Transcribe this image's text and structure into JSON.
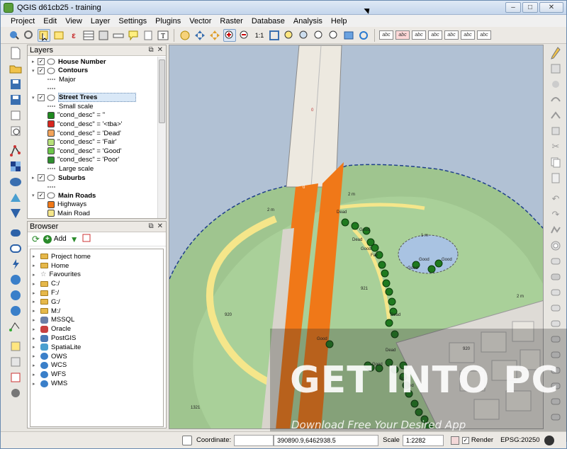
{
  "window": {
    "title": "QGIS d61cb25 - training"
  },
  "menubar": [
    "Project",
    "Edit",
    "View",
    "Layer",
    "Settings",
    "Plugins",
    "Vector",
    "Raster",
    "Database",
    "Analysis",
    "Help"
  ],
  "layers_panel": {
    "title": "Layers",
    "items": [
      {
        "label": "House Number",
        "bold": true,
        "checked": true,
        "expand": "+"
      },
      {
        "label": "Contours",
        "bold": true,
        "checked": true,
        "expand": "-"
      },
      {
        "label": "Major",
        "bold": false
      },
      {
        "label": "",
        "bold": false
      },
      {
        "label": "Street Trees",
        "bold": true,
        "checked": true,
        "expand": "-",
        "selected": true
      },
      {
        "label": "Small scale",
        "bold": false
      },
      {
        "label": "\"cond_desc\" = ''",
        "bold": false,
        "color": "#1f8a1f"
      },
      {
        "label": "\"cond_desc\" = '<tba>'",
        "bold": false,
        "color": "#d8271f"
      },
      {
        "label": "\"cond_desc\" = 'Dead'",
        "bold": false,
        "color": "#f2a35a"
      },
      {
        "label": "\"cond_desc\" = 'Fair'",
        "bold": false,
        "color": "#b7e07a"
      },
      {
        "label": "\"cond_desc\" = 'Good'",
        "bold": false,
        "color": "#6cc64a"
      },
      {
        "label": "\"cond_desc\" = 'Poor'",
        "bold": false,
        "color": "#2f8f2f"
      },
      {
        "label": "Large scale",
        "bold": false
      },
      {
        "label": "Suburbs",
        "bold": true,
        "checked": true,
        "expand": "+"
      },
      {
        "label": "",
        "bold": false
      },
      {
        "label": "Main Roads",
        "bold": true,
        "checked": true,
        "expand": "-"
      },
      {
        "label": "Highways",
        "bold": false,
        "color": "#f07818"
      },
      {
        "label": "Main Road",
        "bold": false,
        "color": "#f5e68a"
      }
    ]
  },
  "browser_panel": {
    "title": "Browser",
    "add_label": "Add",
    "items": [
      {
        "label": "Project home",
        "kind": "folder"
      },
      {
        "label": "Home",
        "kind": "folder"
      },
      {
        "label": "Favourites",
        "kind": "star"
      },
      {
        "label": "C:/",
        "kind": "folder"
      },
      {
        "label": "F:/",
        "kind": "folder"
      },
      {
        "label": "G:/",
        "kind": "folder"
      },
      {
        "label": "M:/",
        "kind": "folder"
      },
      {
        "label": "MSSQL",
        "kind": "db",
        "color": "#6b7fa8"
      },
      {
        "label": "Oracle",
        "kind": "db",
        "color": "#c94040"
      },
      {
        "label": "PostGIS",
        "kind": "db",
        "color": "#4a78b5"
      },
      {
        "label": "SpatiaLite",
        "kind": "db",
        "color": "#4a9fd0"
      },
      {
        "label": "OWS",
        "kind": "globe",
        "color": "#3a7fc9"
      },
      {
        "label": "WCS",
        "kind": "globe",
        "color": "#3a7fc9"
      },
      {
        "label": "WFS",
        "kind": "globe",
        "color": "#3a7fc9"
      },
      {
        "label": "WMS",
        "kind": "globe",
        "color": "#3a7fc9"
      }
    ]
  },
  "map": {
    "labels": [
      "Dead",
      "Good",
      "Dead",
      "Good",
      "Fair",
      "Good",
      "Good",
      "Good",
      "Dead",
      "Good",
      "Dead",
      "Good",
      "Good",
      "Good",
      "1 m",
      "2 m",
      "2 m",
      "2 m",
      "921",
      "920",
      "920",
      "1321",
      "0",
      "0"
    ]
  },
  "statusbar": {
    "coordinate_label": "Coordinate:",
    "coordinate_value": "390890.9,6462938.5",
    "scale_label": "Scale",
    "scale_value": "1:2282",
    "render_label": "Render",
    "epsg": "EPSG:20250"
  },
  "watermark": {
    "main": "GET INTO PC",
    "sub": "Download Free Your Desired App"
  },
  "colors": {
    "water": "#b1c1d4",
    "park": "#9ec48a",
    "highway": "#f07818",
    "mainroad": "#f5e68a"
  }
}
